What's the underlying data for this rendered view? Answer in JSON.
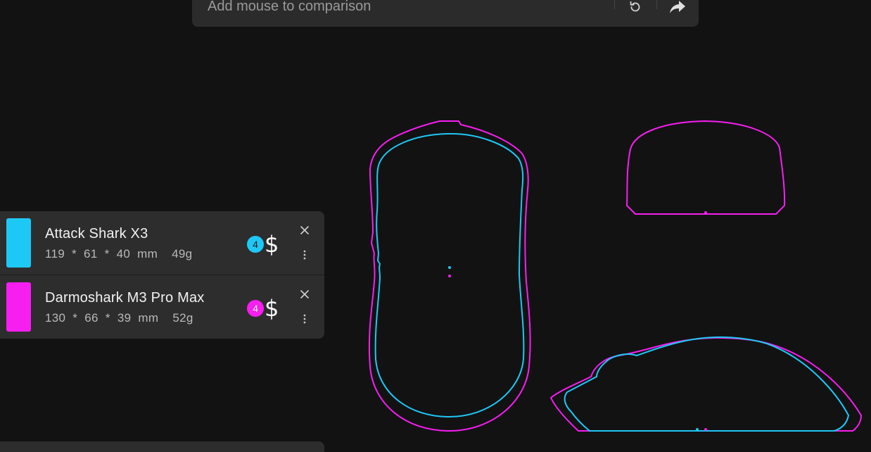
{
  "search": {
    "placeholder": "Add mouse to comparison",
    "reset_icon": "refresh-icon",
    "share_icon": "share-icon"
  },
  "mice": [
    {
      "name": "Attack Shark X3",
      "length": "119",
      "width": "61",
      "height": "40",
      "unit": "mm",
      "weight": "49g",
      "price_tier": "4",
      "price_symbol": "$",
      "color": "#1ec8f5"
    },
    {
      "name": "Darmoshark M3 Pro Max",
      "length": "130",
      "width": "66",
      "height": "39",
      "unit": "mm",
      "weight": "52g",
      "price_tier": "4",
      "price_symbol": "$",
      "color": "#f71ef0"
    }
  ],
  "icons": {
    "close": "close-icon",
    "menu": "more-vertical-icon"
  },
  "colors": {
    "background": "#121213",
    "panel": "#2d2d2e",
    "mouse1": "#1ec8f5",
    "mouse2": "#f71ef0"
  }
}
